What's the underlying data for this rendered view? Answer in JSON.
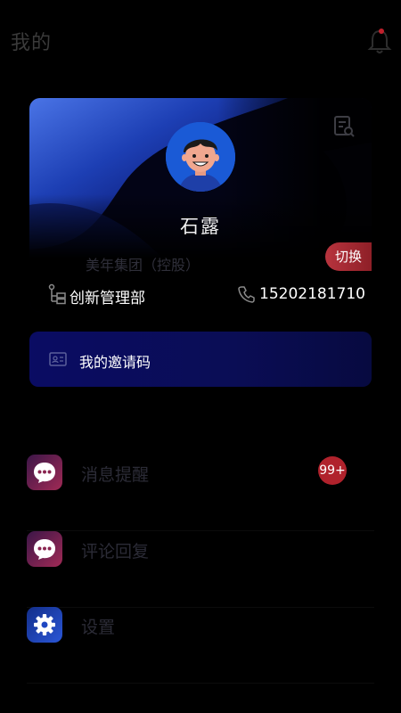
{
  "header": {
    "title": "我的",
    "notification_icon": "bell-icon"
  },
  "profile": {
    "name": "石露",
    "company": "美年集团（控股）",
    "switch_label": "切换",
    "department": "创新管理部",
    "phone": "15202181710",
    "icons": {
      "document": "document-search-icon",
      "department": "org-chart-icon",
      "phone": "phone-icon",
      "avatar": "avatar-cartoon"
    }
  },
  "invite": {
    "label": "我的邀请码",
    "icon": "id-card-icon"
  },
  "menu": {
    "items": [
      {
        "label": "消息提醒",
        "icon": "chat-bubble-icon",
        "badge": "99+"
      },
      {
        "label": "评论回复",
        "icon": "chat-bubble-icon"
      },
      {
        "label": "设置",
        "icon": "gear-icon"
      }
    ]
  },
  "colors": {
    "background": "#000000",
    "accent_red": "#b0222c",
    "invite_blue": "#0a0c63",
    "gear_blue": "#2a56d6"
  }
}
